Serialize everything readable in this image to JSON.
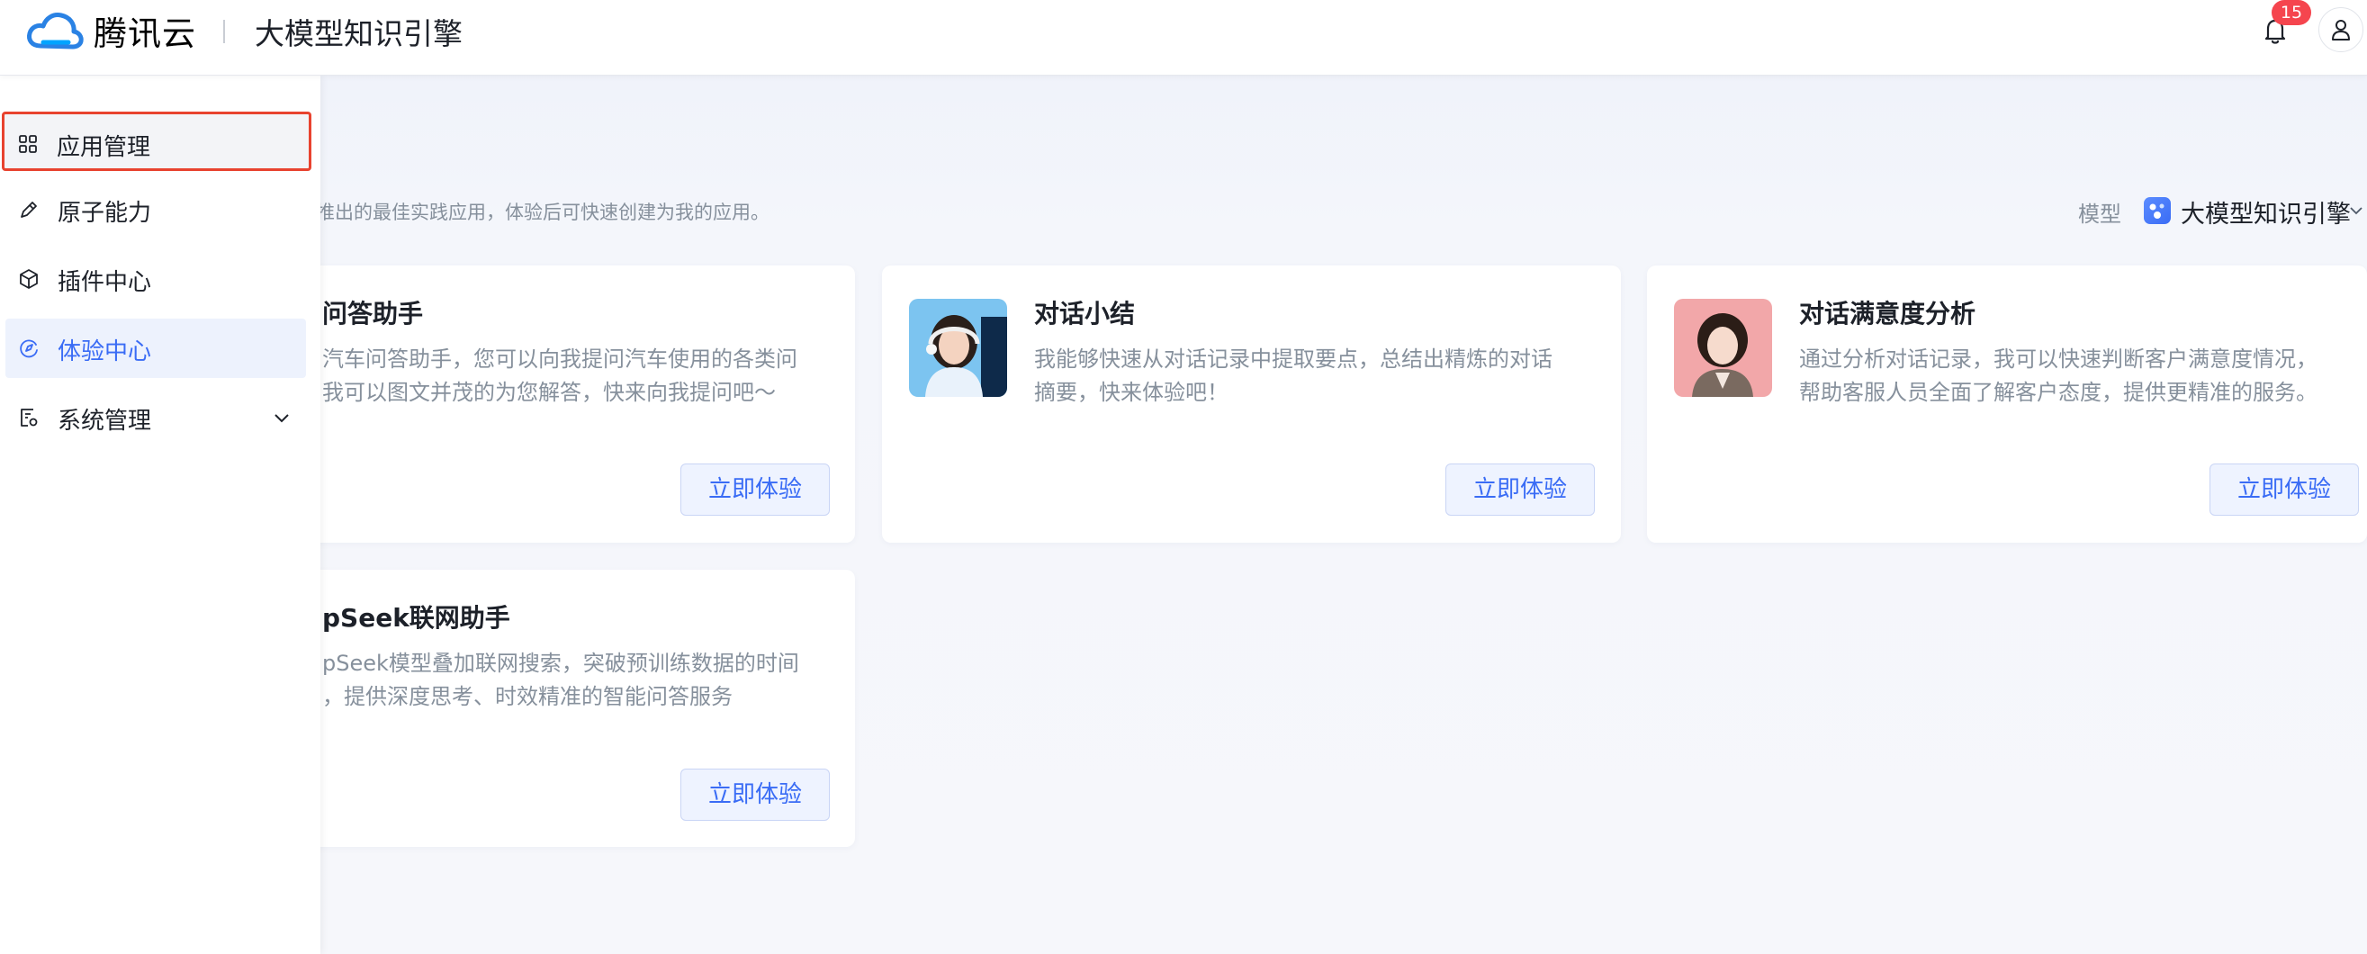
{
  "header": {
    "brand_name": "腾讯云",
    "product_name": "大模型知识引擎",
    "notification_count": "15"
  },
  "sidebar": {
    "items": [
      {
        "label": "应用管理",
        "icon": "grid-icon"
      },
      {
        "label": "原子能力",
        "icon": "pen-icon"
      },
      {
        "label": "插件中心",
        "icon": "cube-icon"
      },
      {
        "label": "体验中心",
        "icon": "compass-icon"
      },
      {
        "label": "系统管理",
        "icon": "settings-doc-icon"
      }
    ]
  },
  "main": {
    "intro": "推出的最佳实践应用，体验后可快速创建为我的应用。",
    "model_label": "模型",
    "model_value": "大模型知识引擎",
    "cards": [
      {
        "title": "问答助手",
        "desc_line1": "汽车问答助手，您可以向我提问汽车使用的各类问",
        "desc_line2": "我可以图文并茂的为您解答，快来向我提问吧～",
        "button": "立即体验"
      },
      {
        "title": "对话小结",
        "desc_line1": "我能够快速从对话记录中提取要点，总结出精炼的对话",
        "desc_line2": "摘要，快来体验吧！",
        "button": "立即体验"
      },
      {
        "title": "对话满意度分析",
        "desc_line1": "通过分析对话记录，我可以快速判断客户满意度情况，",
        "desc_line2": "帮助客服人员全面了解客户态度，提供更精准的服务。",
        "button": "立即体验"
      },
      {
        "title": "pSeek联网助手",
        "desc_line1": "pSeek模型叠加联网搜索，突破预训练数据的时间",
        "desc_line2": "，提供深度思考、时效精准的智能问答服务",
        "button": "立即体验"
      }
    ]
  },
  "colors": {
    "accent": "#3a6cf5",
    "highlight_border": "#e8432f",
    "badge": "#f5454e"
  }
}
